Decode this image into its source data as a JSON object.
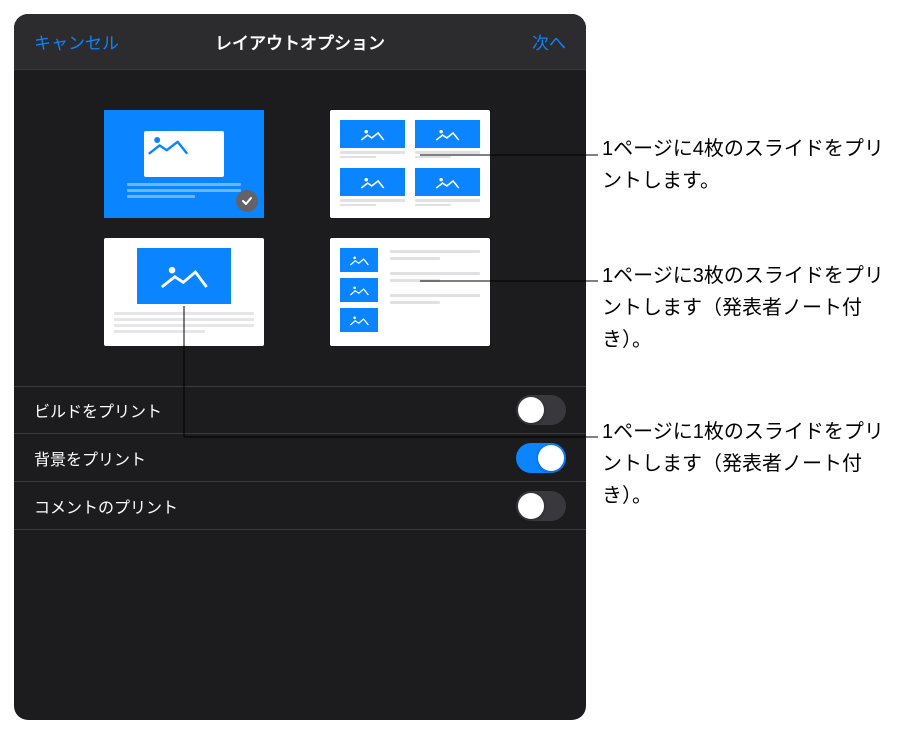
{
  "header": {
    "cancel": "キャンセル",
    "title": "レイアウトオプション",
    "next": "次へ"
  },
  "layouts": {
    "single_slide": {
      "selected": true
    },
    "four_up": {
      "selected": false
    },
    "one_with_notes": {
      "selected": false
    },
    "three_with_notes": {
      "selected": false
    }
  },
  "settings": {
    "print_builds": {
      "label": "ビルドをプリント",
      "on": false
    },
    "print_background": {
      "label": "背景をプリント",
      "on": true
    },
    "print_comments": {
      "label": "コメントのプリント",
      "on": false
    }
  },
  "callouts": {
    "c1": "1ページに4枚のスライドをプリントします。",
    "c2": "1ページに3枚のスライドをプリントします（発表者ノート付き）。",
    "c3": "1ページに1枚のスライドをプリントします（発表者ノート付き）。"
  }
}
